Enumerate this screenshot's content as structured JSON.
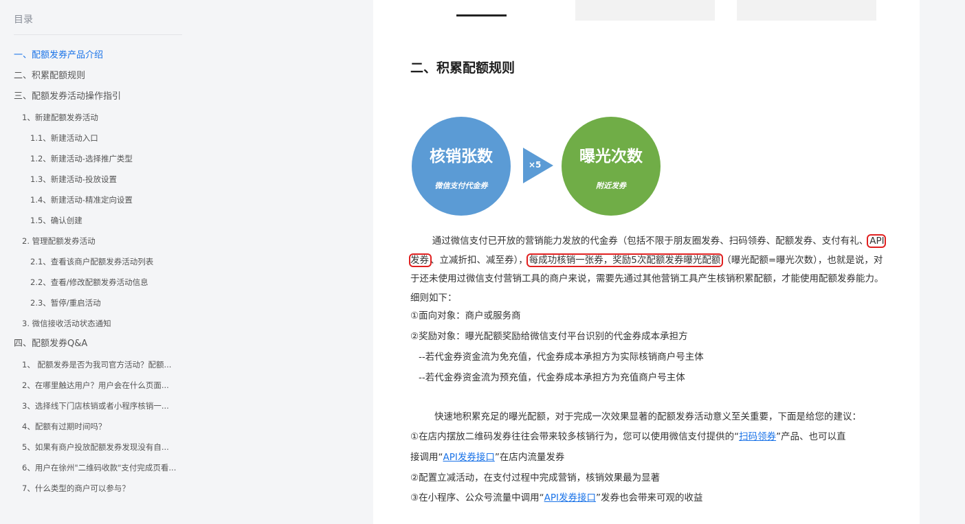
{
  "toc": {
    "title": "目录",
    "items": [
      {
        "label": "一、配额发券产品介绍",
        "level": 1,
        "active": true
      },
      {
        "label": "二、积累配额规则",
        "level": 1
      },
      {
        "label": "三、配额发券活动操作指引",
        "level": 1
      },
      {
        "label": "1、新建配额发券活动",
        "level": 2
      },
      {
        "label": "1.1、新建活动入口",
        "level": 3
      },
      {
        "label": "1.2、新建活动-选择推广类型",
        "level": 3
      },
      {
        "label": "1.3、新建活动-投放设置",
        "level": 3
      },
      {
        "label": "1.4、新建活动-精准定向设置",
        "level": 3
      },
      {
        "label": "1.5、确认创建",
        "level": 3
      },
      {
        "label": "2. 管理配额发券活动",
        "level": 2
      },
      {
        "label": "2.1、查看该商户配额发券活动列表",
        "level": 3
      },
      {
        "label": "2.2、查看/修改配额发券活动信息",
        "level": 3
      },
      {
        "label": "2.3、暂停/重启活动",
        "level": 3
      },
      {
        "label": "3. 微信接收活动状态通知",
        "level": 2
      },
      {
        "label": "四、配额发券Q&A",
        "level": 1
      },
      {
        "label": "1、 配额发券是否为我司官方活动？配额...",
        "level": 2
      },
      {
        "label": "2、在哪里触达用户？用户会在什么页面...",
        "level": 2
      },
      {
        "label": "3、选择线下门店核销或者小程序核销一...",
        "level": 2
      },
      {
        "label": "4、配额有过期时间吗？",
        "level": 2
      },
      {
        "label": "5、如果有商户投放配额发券发现没有自...",
        "level": 2
      },
      {
        "label": "6、用户在徐州\"二维码收款\"支付完成页看...",
        "level": 2
      },
      {
        "label": "7、什么类型的商户可以参与？",
        "level": 2
      }
    ]
  },
  "content": {
    "heading": "二、积累配额规则",
    "diagram": {
      "left_title": "核销张数",
      "left_sub": "微信支付代金券",
      "arrow_label": "×5",
      "right_title": "曝光次数",
      "right_sub": "附近发券",
      "left_color": "#5b9bd5",
      "right_color": "#70ad47",
      "arrow_color": "#5b9bd5"
    },
    "para1": {
      "part1": "通过微信支付已开放的营销能力发放的代金券（包括不限于朋友圈发券、扫码领券、配额发券、支付有礼、",
      "hl1": "API发券",
      "part2": "、立减折扣、减至券），",
      "hl2": "每成功核销一张券，奖励5次配额发券曝光配额",
      "part3": "（曝光配额=曝光次数），也就是说，对于还未使用过微信支付营销工具的商户来说，需要先通过其他营销工具产生核销积累配额，才能使用配额发券能力。细则如下："
    },
    "rule1": "①面向对象：商户或服务商",
    "rule2": "②奖励对象：曝光配额奖励给微信支付平台识别的代金券成本承担方",
    "rule2a": "--若代金券资金流为免充值，代金券成本承担方为实际核销商户号主体",
    "rule2b": "--若代金券资金流为预充值，代金券成本承担方为充值商户号主体",
    "para2": "快速地积累充足的曝光配额，对于完成一次效果显著的配额发券活动意义至关重要，下面是给您的建议：",
    "tip1_a": "①在店内摆放二维码发券往往会带来较多核销行为，您可以使用微信支付提供的“",
    "tip1_link1": "扫码领券",
    "tip1_b": "”产品、也可以直",
    "tip1_c": "接调用“",
    "tip1_link2": "API发券接口",
    "tip1_d": "”在店内流量发券",
    "tip2": "②配置立减活动，在支付过程中完成营销，核销效果最为显著",
    "tip3_a": "③在小程序、公众号流量中调用“",
    "tip3_link": "API发券接口",
    "tip3_b": "”发券也会带来可观的收益"
  }
}
